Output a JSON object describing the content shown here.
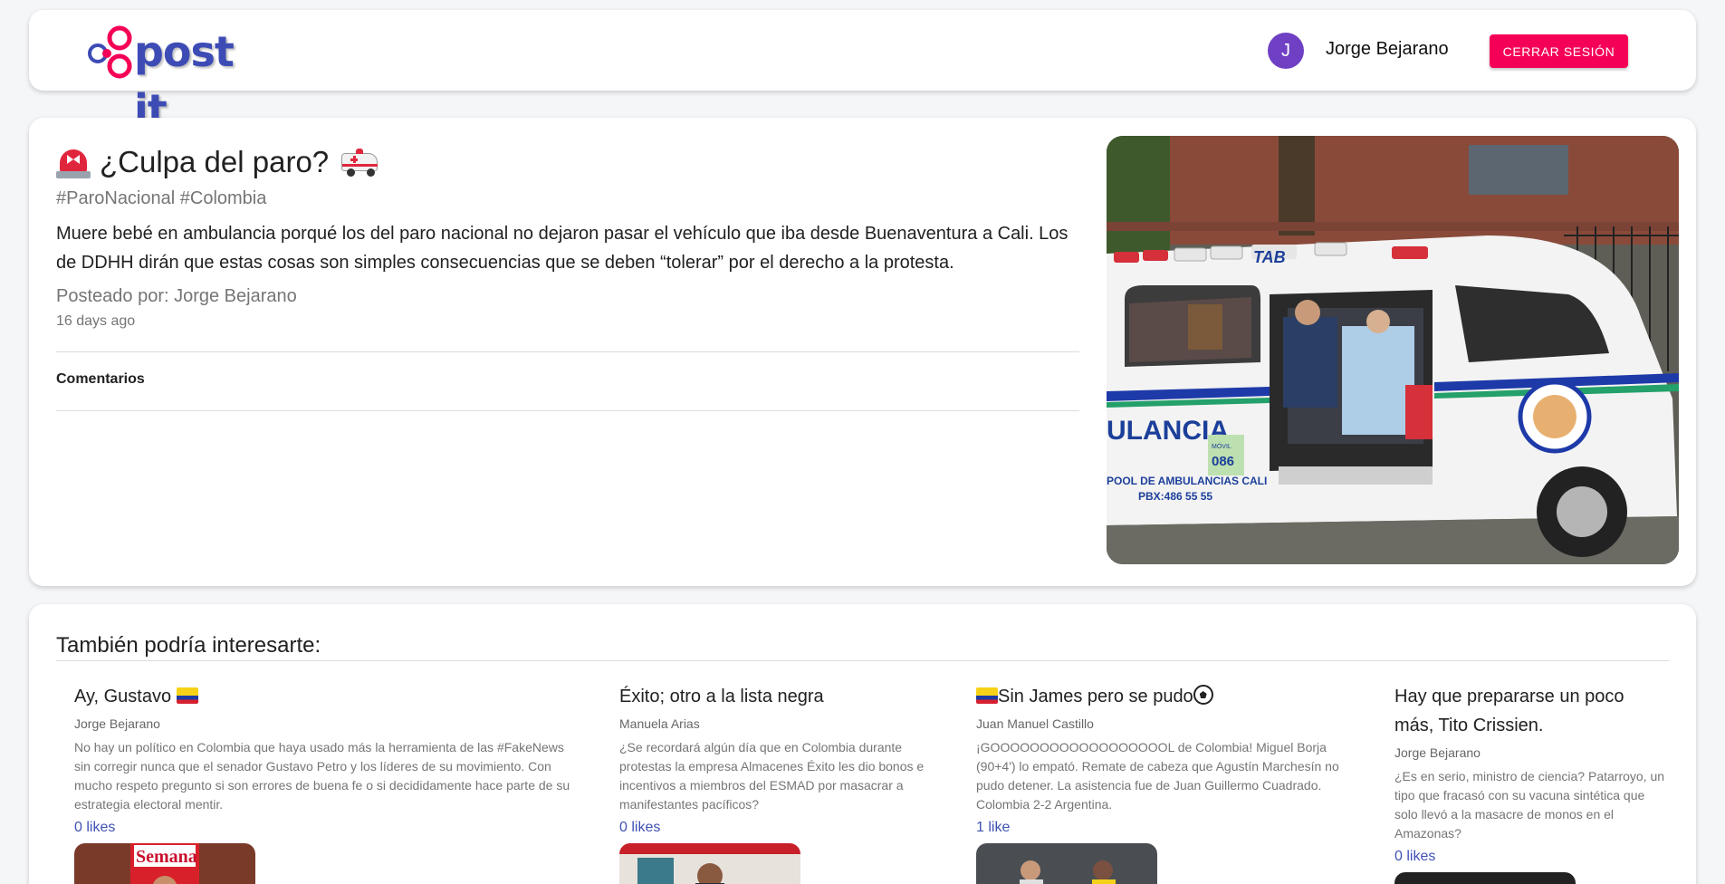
{
  "header": {
    "logo_text": "post it",
    "avatar_initial": "J",
    "user_name": "Jorge Bejarano",
    "logout_label": "CERRAR SESIÓN"
  },
  "post": {
    "title": "¿Culpa del paro?",
    "tags": "#ParoNacional #Colombia",
    "body": "Muere bebé en ambulancia porqué los del paro nacional no dejaron pasar el vehículo que iba desde Buenaventura a Cali. Los de DDHH dirán que estas cosas son simples consecuencias que se deben “tolerar” por el derecho a la protesta.",
    "author_line": "Posteado por: Jorge Bejarano",
    "date": "16 days ago",
    "comments_label": "Comentarios",
    "image_text": {
      "brand": "TAB",
      "side_label": "ULANCIA",
      "footer_line1": "POOL DE AMBULANCIAS CALI",
      "footer_line2": "PBX:486 55 55",
      "unit_label": "MÓVIL",
      "unit_number": "086"
    }
  },
  "recommendations": {
    "title": "También podría interesarte:",
    "items": [
      {
        "title": "Ay, Gustavo",
        "author": "Jorge Bejarano",
        "text": "No hay un político en Colombia que haya usado más la herramienta de las #FakeNews sin corregir nunca que el senador Gustavo Petro y los líderes de su movimiento. Con mucho respeto pregunto si son errores de buena fe o si decididamente hace parte de su estrategia electoral mentir.",
        "likes": "0 likes",
        "thumb_text": "Semana"
      },
      {
        "title": "Éxito; otro a la lista negra",
        "author": "Manuela Arias",
        "text": "¿Se recordará algún día que en Colombia durante protestas la empresa Almacenes Éxito les dio bonos e incentivos a miembros del ESMAD por masacrar a manifestantes pacíficos?",
        "likes": "0 likes"
      },
      {
        "title": "Sin James pero se pudo",
        "author": "Juan Manuel Castillo",
        "text": "¡GOOOOOOOOOOOOOOOOOOL de Colombia! Miguel Borja (90+4') lo empató. Remate de cabeza que Agustín Marchesín no pudo detener. La asistencia fue de Juan Guillermo Cuadrado. Colombia 2-2 Argentina.",
        "likes": "1 like"
      },
      {
        "title": "Hay que prepararse un poco más, Tito Crissien.",
        "author": "Jorge Bejarano",
        "text": "¿Es en serio, ministro de ciencia? Patarroyo, un tipo que fracasó con su vacuna sintética que solo llevó a la masacre de monos en el Amazonas?",
        "likes": "0 likes"
      }
    ]
  }
}
